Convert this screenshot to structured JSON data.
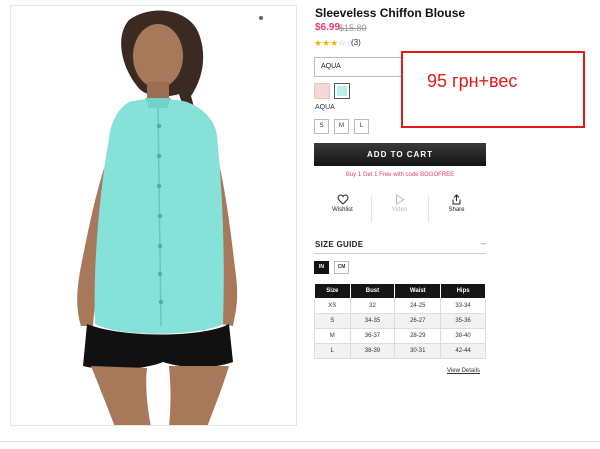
{
  "product": {
    "title": "Sleeveless Chiffon Blouse",
    "sale_price": "$6.99",
    "original_price": "$15.80",
    "rating": {
      "stars_filled": 3,
      "stars_total": 5,
      "review_count": "(3)"
    }
  },
  "color_select": {
    "value": "AQUA"
  },
  "swatches": [
    {
      "name": "pink",
      "color": "#f3d9d3",
      "selected": false
    },
    {
      "name": "aqua",
      "color": "#bdeeec",
      "selected": true
    }
  ],
  "selected_color_label": "AQUA",
  "sizes": [
    "S",
    "M",
    "L"
  ],
  "add_to_cart_label": "ADD TO CART",
  "promo_text": "Buy 1 Get 1 Free with code BOGOFREE",
  "actions": {
    "wishlist": "Wishlist",
    "video": "Video",
    "share": "Share"
  },
  "size_guide": {
    "title": "SIZE GUIDE",
    "toggle": "–",
    "units": {
      "in": "IN",
      "cm": "CM",
      "active": "IN"
    },
    "headers": [
      "Size",
      "Bust",
      "Waist",
      "Hips"
    ],
    "rows": [
      [
        "XS",
        "32",
        "24-25",
        "33-34"
      ],
      [
        "S",
        "34-35",
        "26-27",
        "35-36"
      ],
      [
        "M",
        "36-37",
        "28-29",
        "38-40"
      ],
      [
        "L",
        "38-39",
        "30-31",
        "42-44"
      ]
    ],
    "view_details": "View Details"
  },
  "annotation": {
    "text": "95 грн+вес",
    "color": "#e11b1b"
  },
  "colors": {
    "accent_pink": "#e53b7a",
    "star": "#f0b400",
    "cart": "#141414"
  }
}
